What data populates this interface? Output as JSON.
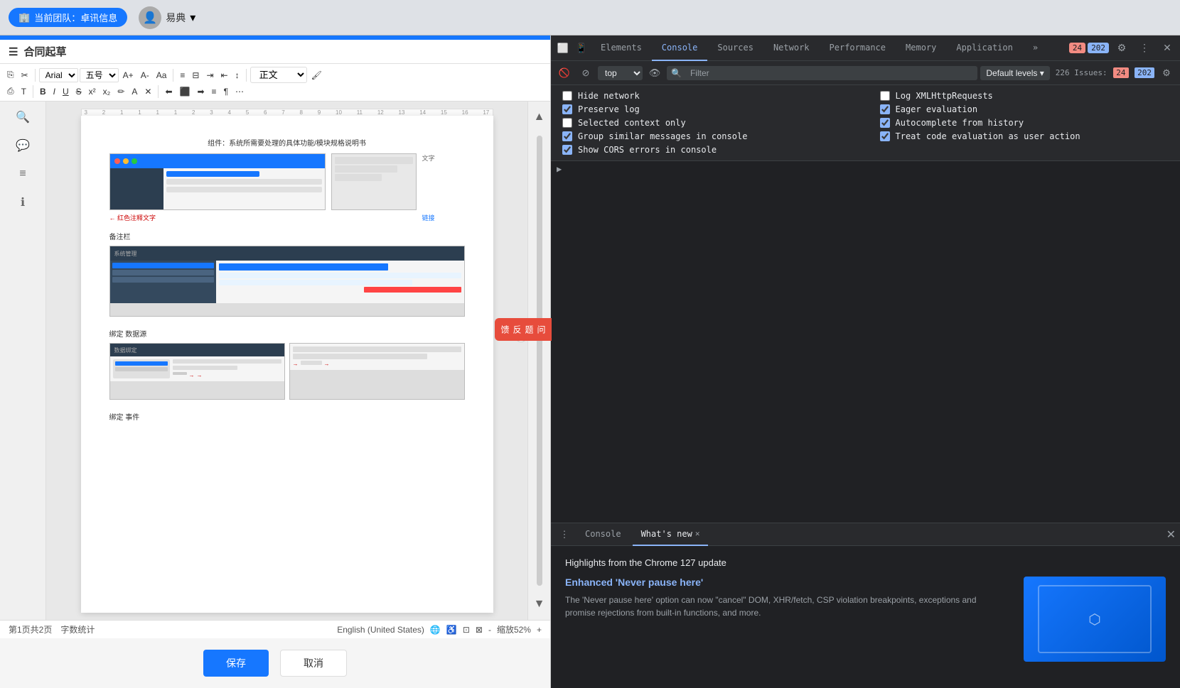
{
  "browser": {
    "team_label": "当前团队：卓讯信息",
    "username": "易典",
    "chevron": "▾"
  },
  "editor": {
    "title": "合同起草",
    "font_family": "Arial",
    "font_size": "五号",
    "style_label": "正文",
    "page_info": "第1页共2页",
    "word_count_label": "字数统计",
    "language": "English (United States)",
    "zoom": "缩放52%",
    "save_button": "保存",
    "cancel_button": "取消",
    "feedback_text": "问题反馈",
    "toolbar": {
      "bold": "B",
      "italic": "I",
      "underline": "U",
      "strikethrough": "S"
    }
  },
  "devtools": {
    "tabs": [
      {
        "label": "Elements",
        "active": false
      },
      {
        "label": "Console",
        "active": true
      },
      {
        "label": "Sources",
        "active": false
      },
      {
        "label": "Network",
        "active": false
      },
      {
        "label": "Performance",
        "active": false
      },
      {
        "label": "Memory",
        "active": false
      },
      {
        "label": "Application",
        "active": false
      }
    ],
    "toolbar": {
      "context_selector": "top",
      "filter_placeholder": "Filter",
      "levels_label": "Default levels",
      "issues_count_red": "24",
      "issues_count_blue": "202",
      "issues_label": "226 Issues:"
    },
    "settings": {
      "left": [
        {
          "label": "Hide network",
          "checked": false
        },
        {
          "label": "Preserve log",
          "checked": true
        },
        {
          "label": "Selected context only",
          "checked": false
        },
        {
          "label": "Group similar messages in console",
          "checked": true
        },
        {
          "label": "Show CORS errors in console",
          "checked": true
        }
      ],
      "right": [
        {
          "label": "Log XMLHttpRequests",
          "checked": false
        },
        {
          "label": "Eager evaluation",
          "checked": true
        },
        {
          "label": "Autocomplete from history",
          "checked": true
        },
        {
          "label": "Treat code evaluation as user action",
          "checked": true
        }
      ]
    },
    "bottom": {
      "tabs": [
        {
          "label": "Console",
          "active": false
        },
        {
          "label": "What's new",
          "active": true,
          "closable": true
        }
      ],
      "whats_new": {
        "summary": "Highlights from the Chrome 127 update",
        "feature_title": "Enhanced 'Never pause here'",
        "feature_desc": "The 'Never pause here' option can now \"cancel\" DOM, XHR/fetch, CSP violation breakpoints, exceptions and promise rejections from built-in functions, and more."
      }
    }
  }
}
